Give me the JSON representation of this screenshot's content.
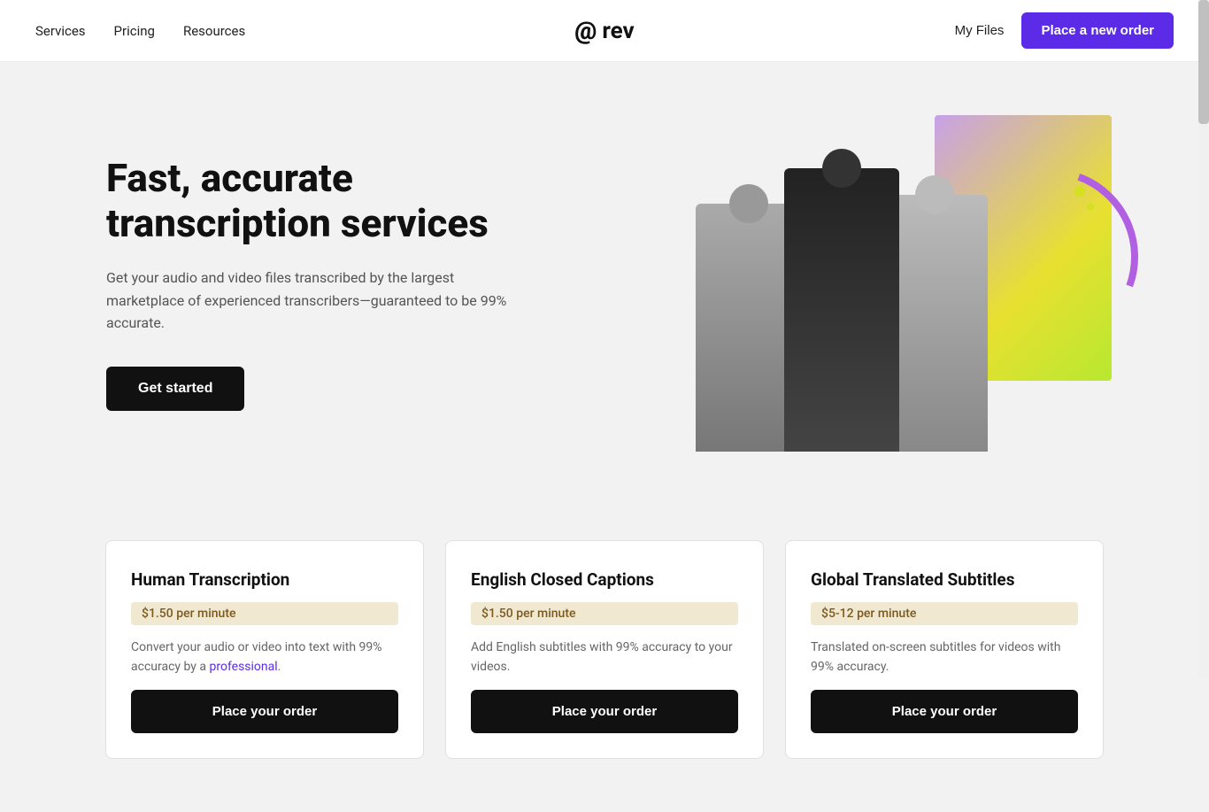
{
  "navbar": {
    "logo": "@ rev",
    "logo_at": "@",
    "logo_rev": "rev",
    "links": [
      {
        "label": "Services",
        "id": "services"
      },
      {
        "label": "Pricing",
        "id": "pricing"
      },
      {
        "label": "Resources",
        "id": "resources"
      }
    ],
    "my_files_label": "My Files",
    "place_order_label": "Place a new order"
  },
  "hero": {
    "title": "Fast, accurate transcription services",
    "subtitle": "Get your audio and video files transcribed by the largest marketplace of experienced transcribers—guaranteed to be 99% accurate.",
    "cta_label": "Get started"
  },
  "cards": [
    {
      "id": "human-transcription",
      "title": "Human Transcription",
      "price": "$1.50 per minute",
      "description": "Convert your audio or video into text with 99% accuracy by a professional.",
      "cta": "Place your order"
    },
    {
      "id": "english-captions",
      "title": "English Closed Captions",
      "price": "$1.50 per minute",
      "description": "Add English subtitles with 99% accuracy to your videos.",
      "cta": "Place your order"
    },
    {
      "id": "global-subtitles",
      "title": "Global Translated Subtitles",
      "price": "$5-12 per minute",
      "description": "Translated on-screen subtitles for videos with 99% accuracy.",
      "cta": "Place your order"
    }
  ]
}
